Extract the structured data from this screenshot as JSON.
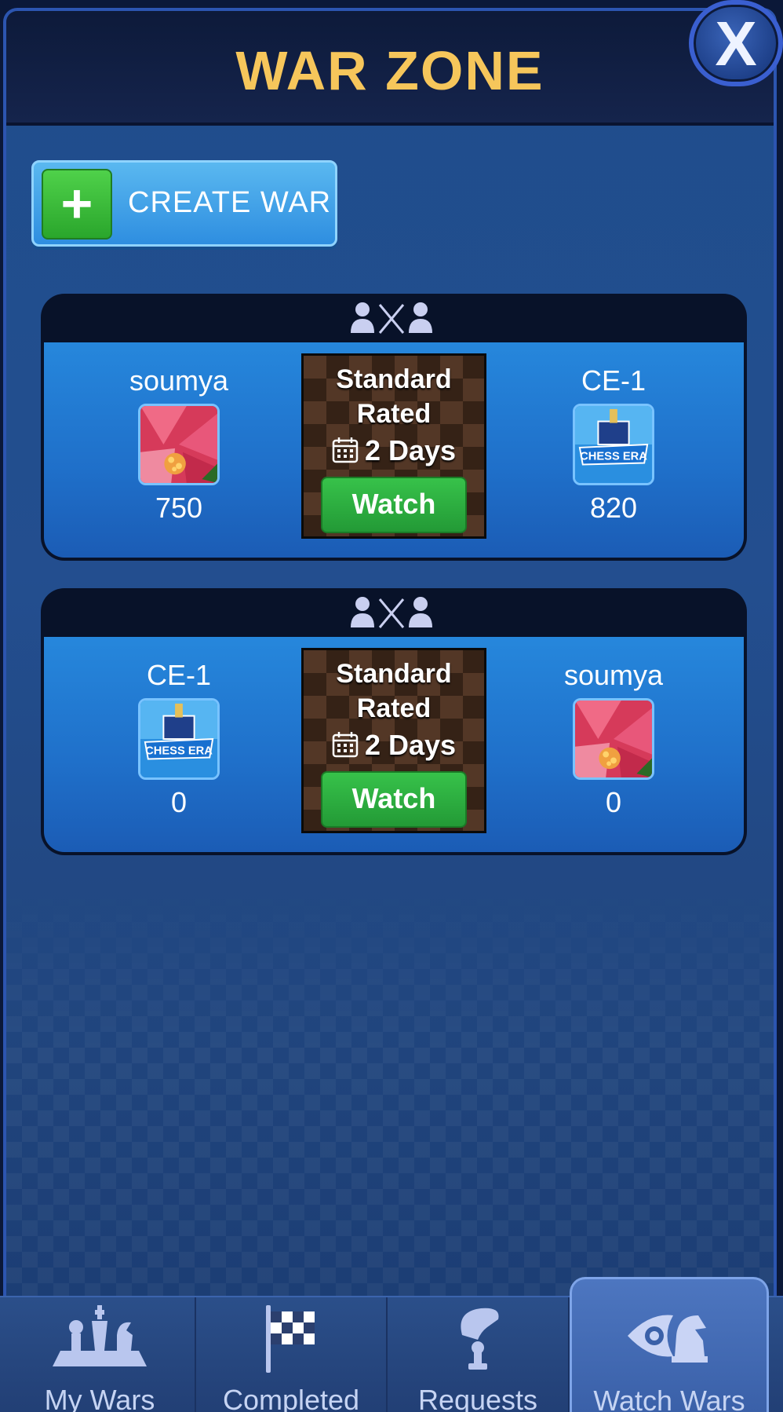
{
  "header": {
    "title": "WAR ZONE",
    "close_label": "X"
  },
  "create_war": {
    "label": "CREATE WAR",
    "icon": "plus-icon"
  },
  "wars": [
    {
      "vs_icon": "players-vs-swords-icon",
      "left_player": {
        "name": "soumya",
        "avatar": "hibiscus-flower",
        "score": "750"
      },
      "right_player": {
        "name": "CE-1",
        "avatar": "chess-era-logo",
        "score": "820"
      },
      "mode_line1": "Standard",
      "mode_line2": "Rated",
      "duration": "2 Days",
      "watch_label": "Watch"
    },
    {
      "vs_icon": "players-vs-swords-icon",
      "left_player": {
        "name": "CE-1",
        "avatar": "chess-era-logo",
        "score": "0"
      },
      "right_player": {
        "name": "soumya",
        "avatar": "hibiscus-flower",
        "score": "0"
      },
      "mode_line1": "Standard",
      "mode_line2": "Rated",
      "duration": "2 Days",
      "watch_label": "Watch"
    }
  ],
  "nav": {
    "tabs": [
      {
        "label": "My Wars",
        "icon": "chess-pieces-icon"
      },
      {
        "label": "Completed",
        "icon": "checkered-flag-icon"
      },
      {
        "label": "Requests",
        "icon": "hand-with-pawn-icon"
      },
      {
        "label": "Watch Wars",
        "icon": "eye-with-knight-icon"
      }
    ],
    "active": "Watch Wars"
  },
  "colors": {
    "title": "#f6c65b",
    "watch_button": "#2bb03f",
    "create_button": "#3a9fe8",
    "panel": "#234e8f"
  }
}
